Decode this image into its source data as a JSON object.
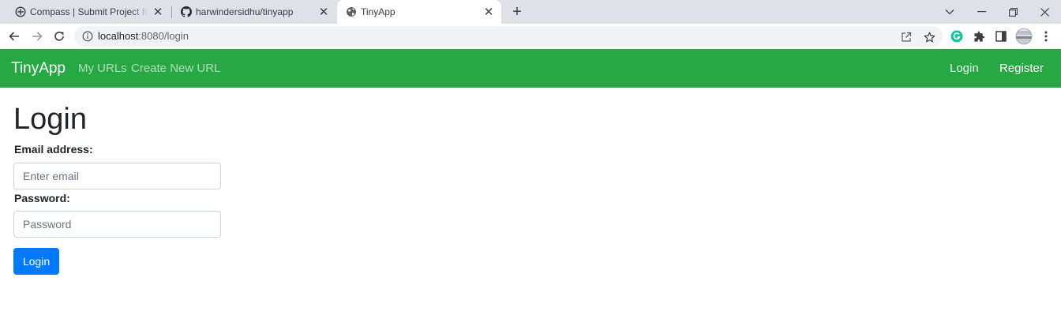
{
  "browser": {
    "tabs": [
      {
        "title": "Compass | Submit Project for Eva",
        "favicon": "compass-icon"
      },
      {
        "title": "harwindersidhu/tinyapp",
        "favicon": "github-icon"
      },
      {
        "title": "TinyApp",
        "favicon": "globe-icon",
        "active": true
      }
    ],
    "close_glyph": "✕",
    "new_tab_glyph": "+",
    "address": {
      "host": "localhost",
      "rest": ":8080/login"
    },
    "icons": [
      "back-icon",
      "forward-icon",
      "reload-icon",
      "info-icon",
      "share-icon",
      "bookmark-star-icon",
      "grammarly-icon",
      "extensions-icon",
      "side-panel-icon",
      "profile-avatar",
      "menu-kebab-icon"
    ],
    "window_controls": {
      "chevron": "⌄",
      "minimize": "—",
      "restore": "❐",
      "close": "✕"
    }
  },
  "navbar": {
    "brand": "TinyApp",
    "links": [
      "My URLs",
      "Create New URL"
    ],
    "right_links": [
      "Login",
      "Register"
    ],
    "color": "#28a745"
  },
  "form": {
    "title": "Login",
    "email_label": "Email address:",
    "email_placeholder": "Enter email",
    "password_label": "Password:",
    "password_placeholder": "Password",
    "submit_label": "Login",
    "button_color": "#007bff"
  }
}
